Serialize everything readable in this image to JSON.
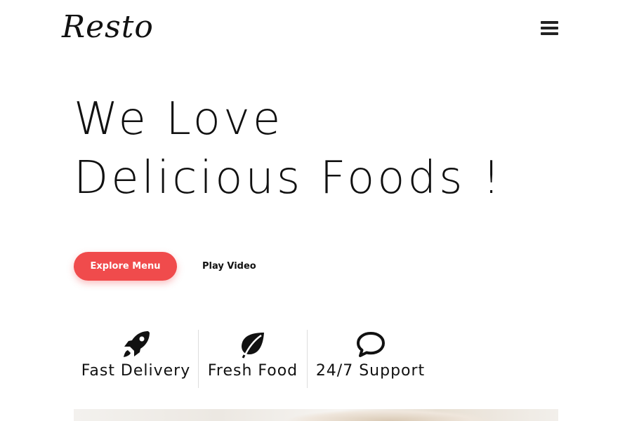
{
  "header": {
    "logo_text": "Resto",
    "menu_icon": "hamburger-menu-icon"
  },
  "hero": {
    "title_line1": "We Love",
    "title_line2": "Delicious Foods !",
    "explore_label": "Explore Menu",
    "video_label": "Play Video"
  },
  "features": [
    {
      "label": "Fast Delivery",
      "icon": "rocket-icon"
    },
    {
      "label": "Fresh Food",
      "icon": "leaf-icon"
    },
    {
      "label": "24/7 Support",
      "icon": "chat-bubble-icon"
    }
  ],
  "colors": {
    "accent": "#f04b4c",
    "text": "#111111",
    "background": "#ffffff",
    "divider": "#dddddd"
  }
}
